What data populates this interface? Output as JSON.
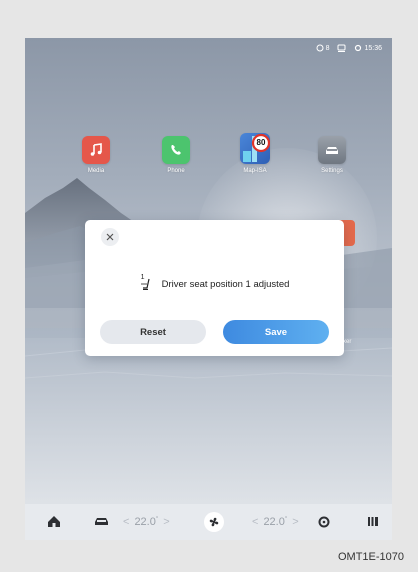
{
  "status_bar": {
    "signal_text": "8",
    "time": "15:36"
  },
  "apps": [
    {
      "label": "Media",
      "icon": "music-note-icon",
      "color": "#e5574a"
    },
    {
      "label": "Phone",
      "icon": "phone-icon",
      "color": "#4cc46e"
    },
    {
      "label": "Map-ISA",
      "icon": "speed-limit-map-icon",
      "speed_limit": "80",
      "color": "#3f74c9"
    },
    {
      "label": "Settings",
      "icon": "car-settings-icon",
      "color": "#8a9099"
    }
  ],
  "partial_app": {
    "label_fragment": "xer"
  },
  "dialog": {
    "message": "Driver seat position 1 adjusted",
    "seat_number": "1",
    "reset_label": "Reset",
    "save_label": "Save",
    "accent_color": "#3e8ae0"
  },
  "climate_bar": {
    "left_temp": "22.0",
    "right_temp": "22.0",
    "degree_symbol": "°",
    "icons": [
      "home-icon",
      "car-icon",
      "fan-icon",
      "steering-heat-icon",
      "seat-heat-icon"
    ]
  },
  "caption": "OMT1E-1070"
}
